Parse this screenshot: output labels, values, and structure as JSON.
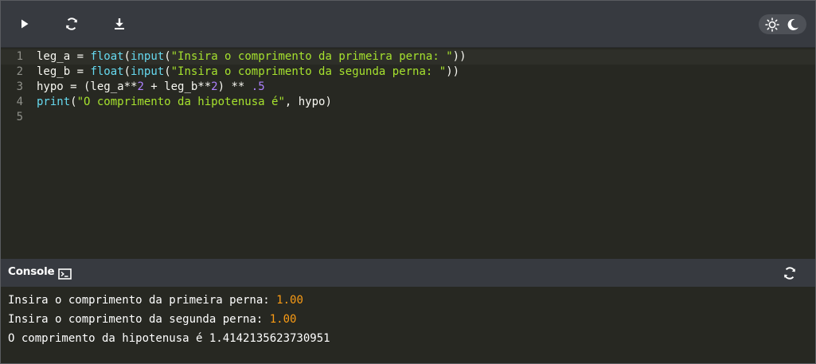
{
  "toolbar": {
    "run_icon": "play-icon",
    "reset_icon": "refresh-icon",
    "download_icon": "download-icon",
    "theme_light_icon": "sun-icon",
    "theme_dark_icon": "moon-icon"
  },
  "editor": {
    "lines": [
      {
        "n": "1",
        "tokens": [
          {
            "t": "leg_a = ",
            "c": "txt"
          },
          {
            "t": "float",
            "c": "fn"
          },
          {
            "t": "(",
            "c": "txt"
          },
          {
            "t": "input",
            "c": "fn"
          },
          {
            "t": "(",
            "c": "txt"
          },
          {
            "t": "\"Insira o comprimento da primeira perna: \"",
            "c": "str"
          },
          {
            "t": "))",
            "c": "txt"
          }
        ]
      },
      {
        "n": "2",
        "tokens": [
          {
            "t": "leg_b = ",
            "c": "txt"
          },
          {
            "t": "float",
            "c": "fn"
          },
          {
            "t": "(",
            "c": "txt"
          },
          {
            "t": "input",
            "c": "fn"
          },
          {
            "t": "(",
            "c": "txt"
          },
          {
            "t": "\"Insira o comprimento da segunda perna: \"",
            "c": "str"
          },
          {
            "t": "))",
            "c": "txt"
          }
        ]
      },
      {
        "n": "3",
        "tokens": [
          {
            "t": "hypo = (leg_a**",
            "c": "txt"
          },
          {
            "t": "2",
            "c": "num"
          },
          {
            "t": " + leg_b**",
            "c": "txt"
          },
          {
            "t": "2",
            "c": "num"
          },
          {
            "t": ") ** ",
            "c": "txt"
          },
          {
            "t": ".5",
            "c": "num"
          }
        ]
      },
      {
        "n": "4",
        "tokens": [
          {
            "t": "print",
            "c": "fn"
          },
          {
            "t": "(",
            "c": "txt"
          },
          {
            "t": "\"O comprimento da hipotenusa é\"",
            "c": "str"
          },
          {
            "t": ", hypo)",
            "c": "txt"
          }
        ]
      },
      {
        "n": "5",
        "tokens": []
      }
    ]
  },
  "console": {
    "title": "Console",
    "terminal_icon": "terminal-icon",
    "refresh_icon": "refresh-icon",
    "output": [
      {
        "prefix": "Insira o comprimento da primeira perna: ",
        "input": "1.00"
      },
      {
        "prefix": "Insira o comprimento da segunda perna: ",
        "input": "1.00"
      },
      {
        "prefix": "O comprimento da hipotenusa é 1.4142135623730951",
        "input": ""
      }
    ]
  },
  "colors": {
    "background": "#272822",
    "toolbar": "#373a40",
    "function": "#66d9ef",
    "string": "#a6e22e",
    "number": "#ae81ff",
    "console_input": "#f99b15"
  }
}
